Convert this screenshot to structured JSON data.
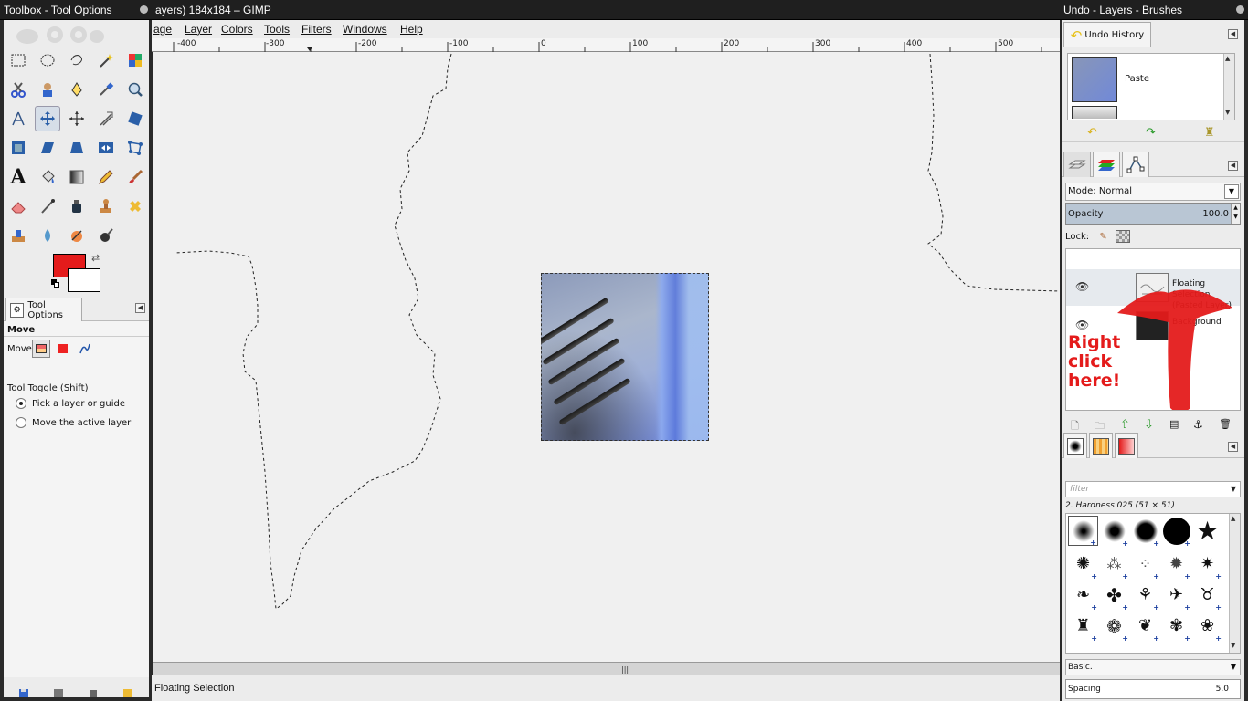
{
  "toolbox": {
    "title": "Toolbox - Tool Options",
    "fg_color": "#e41b1b",
    "bg_color": "#ffffff",
    "tool_options": {
      "tab_label": "Tool Options",
      "tool_name": "Move",
      "move_label": "Move:",
      "move_modes": [
        "layer",
        "selection",
        "path"
      ],
      "toggle_label": "Tool Toggle  (Shift)",
      "options": [
        {
          "label": "Pick a layer or guide",
          "selected": true
        },
        {
          "label": "Move the active layer",
          "selected": false
        }
      ]
    },
    "tools": [
      "rect-select",
      "ellipse-select",
      "free-select",
      "fuzzy-select",
      "select-by-color",
      "scissors-select",
      "foreground-select",
      "paths",
      "color-picker",
      "zoom",
      "measure",
      "move",
      "align",
      "crop",
      "rotate",
      "scale",
      "shear",
      "perspective",
      "flip",
      "cage-transform",
      "text",
      "bucket-fill",
      "blend",
      "pencil",
      "paintbrush",
      "eraser",
      "airbrush",
      "ink",
      "clone",
      "heal",
      "perspective-clone",
      "blur-sharpen",
      "smudge",
      "dodge-burn"
    ],
    "active_tool": "move"
  },
  "image_window": {
    "title": "ayers) 184x184 – GIMP",
    "menu": [
      "age",
      "Layer",
      "Colors",
      "Tools",
      "Filters",
      "Windows",
      "Help"
    ],
    "ruler_labels": [
      "-400",
      "-300",
      "-200",
      "-100",
      "0",
      "100",
      "200",
      "300",
      "400",
      "500"
    ],
    "status_text": "Floating Selection"
  },
  "dock": {
    "title": "Undo - Layers - Brushes",
    "undo": {
      "tab_label": "Undo History",
      "entry_label": "Paste"
    },
    "layers": {
      "mode_label": "Mode:",
      "mode_value": "Normal",
      "opacity_label": "Opacity",
      "opacity_value": "100.0",
      "lock_label": "Lock:",
      "rows": [
        {
          "name_line1": "Floating Selection",
          "name_line2": "(Pasted Layer)"
        },
        {
          "name_line1": "Background",
          "name_line2": ""
        }
      ],
      "annotation": "Right click here!",
      "annotation_color": "#e41b1b"
    },
    "brushes": {
      "filter_placeholder": "filter",
      "brush_name": "2. Hardness 025 (51 × 51)",
      "preset": "Basic.",
      "spacing_label": "Spacing",
      "spacing_value": "5.0"
    }
  }
}
